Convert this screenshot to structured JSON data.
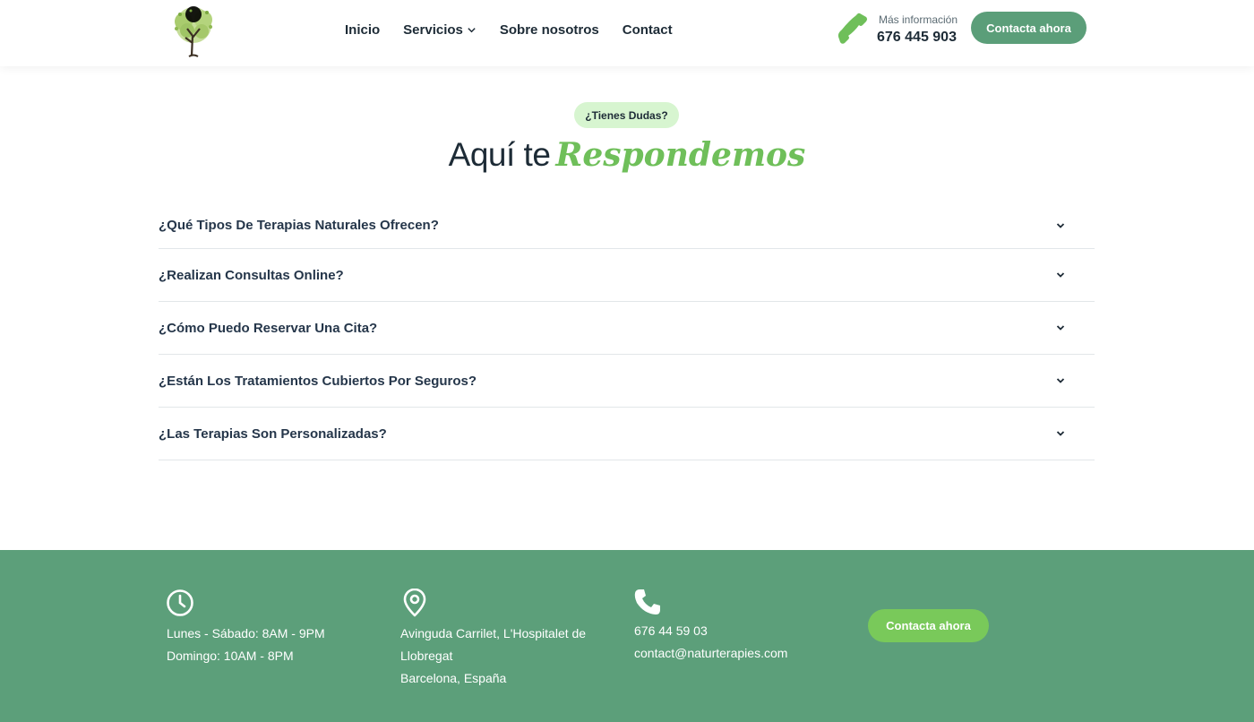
{
  "header": {
    "logo_icon": "tree-icon",
    "nav": [
      {
        "label": "Inicio"
      },
      {
        "label": "Servicios",
        "has_dropdown": true
      },
      {
        "label": "Sobre nosotros"
      },
      {
        "label": "Contact"
      }
    ],
    "phone_caption": "Más información",
    "phone_number": "676 445 903",
    "cta_label": "Contacta ahora"
  },
  "faq_section": {
    "badge": "¿Tienes Dudas?",
    "heading_plain": "Aquí te",
    "heading_script": "Respondemos",
    "items": [
      {
        "question": "¿Qué Tipos De Terapias Naturales Ofrecen?"
      },
      {
        "question": "¿Realizan Consultas Online?"
      },
      {
        "question": "¿Cómo Puedo Reservar Una Cita?"
      },
      {
        "question": "¿Están Los Tratamientos Cubiertos Por Seguros?"
      },
      {
        "question": "¿Las Terapias Son Personalizadas?"
      }
    ]
  },
  "footer": {
    "hours": [
      "Lunes - Sábado: 8AM - 9PM",
      "Domingo: 10AM - 8PM"
    ],
    "address": [
      "Avinguda Carrilet, L'Hospitalet de",
      "Llobregat",
      "Barcelona, España"
    ],
    "contact": [
      "676 44 59 03",
      "contact@naturterapies.com"
    ],
    "cta_label": "Contacta ahora"
  },
  "colors": {
    "brand_green": "#5b9e79",
    "accent_green": "#79c95a",
    "badge_bg": "#d7f5d0",
    "text_dark": "#1d2b36"
  }
}
